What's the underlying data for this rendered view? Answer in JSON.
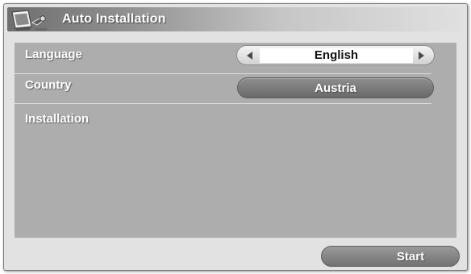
{
  "window": {
    "title": "Auto Installation",
    "icon": "tv-setup-icon"
  },
  "settings": {
    "language": {
      "label": "Language",
      "value": "English"
    },
    "country": {
      "label": "Country",
      "value": "Austria"
    },
    "installation": {
      "label": "Installation"
    }
  },
  "actions": {
    "start_label": "Start"
  },
  "colors": {
    "panel": "#adadad",
    "dialog": "#e2e2e2",
    "highlight_pill": "#7a7a7a",
    "text": "#ffffff"
  }
}
